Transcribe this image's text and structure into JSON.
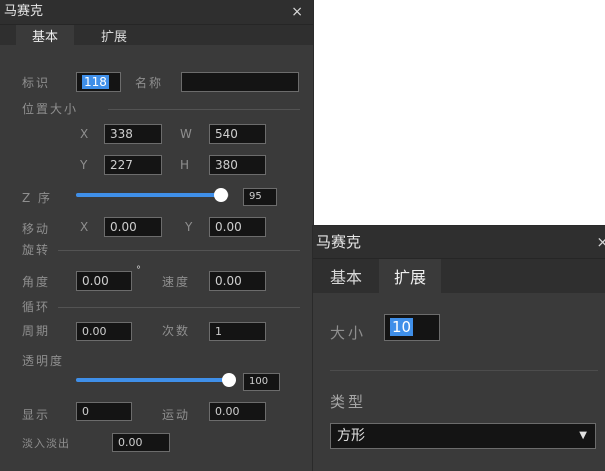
{
  "panel_basic": {
    "title": "马赛克",
    "close": "×",
    "tabs": [
      "基本",
      "扩展"
    ],
    "id_label": "标识",
    "id_value": "118",
    "name_label": "名称",
    "name_value": "",
    "position_size_label": "位置大小",
    "x_label": "X",
    "x_value": "338",
    "w_label": "W",
    "w_value": "540",
    "y_label": "Y",
    "y_value": "227",
    "h_label": "H",
    "h_value": "380",
    "zorder_label": "Z 序",
    "zorder_value": "95",
    "zorder_fraction": 0.95,
    "move_label": "移动",
    "move_x_label": "X",
    "move_x_value": "0.00",
    "move_y_label": "Y",
    "move_y_value": "0.00",
    "rotate_label": "旋转",
    "angle_label": "角度",
    "angle_value": "0.00",
    "degree_symbol": "°",
    "speed_label": "速度",
    "speed_value": "0.00",
    "loop_label": "循环",
    "period_label": "周期",
    "period_value": "0.00",
    "count_label": "次数",
    "count_value": "1",
    "opacity_label": "透明度",
    "opacity_value": "100",
    "opacity_fraction": 1.0,
    "display_label": "显示",
    "display_value": "0",
    "motion_label": "运动",
    "motion_value": "0.00",
    "fade_label": "淡入淡出",
    "fade_value": "0.00"
  },
  "panel_extended": {
    "title": "马赛克",
    "close": "×",
    "tabs": [
      "基本",
      "扩展"
    ],
    "size_label": "大小",
    "size_value": "10",
    "type_label": "类型",
    "type_value": "方形",
    "dropdown_arrow": "▼"
  },
  "colors": {
    "accent": "#3f8fe9",
    "panel_bg": "#3a3a3a",
    "title_bg": "#2f2f2f",
    "input_bg": "#141414"
  }
}
